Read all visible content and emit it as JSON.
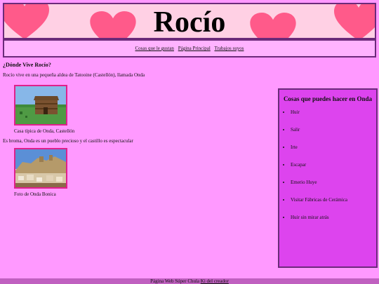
{
  "header": {
    "title": "Rocío",
    "background_color": "#ffd0e4",
    "heart_color": "#ff5a8a"
  },
  "nav": {
    "links": [
      "Cosas que le gustan",
      "Página Principal",
      "Trabajos suyos"
    ]
  },
  "main": {
    "section_title": "¿Dónde Vive Rocío?",
    "intro": "Rocío vive en una pequeña aldea de Tatooine (Castellón), llamada Onda",
    "photo1_caption": "Casa típica de Onda, Castellón",
    "note": "Es broma, Onda es un pueblo precioso y el castillo es espectacular",
    "photo2_caption": "Foto de Onda Bonica"
  },
  "sidebar": {
    "title": "Cosas que puedes hacer en Onda",
    "items": [
      "Huir",
      "Salir",
      "Irte",
      "Escapar",
      "Emerio Huye",
      "Visitar Fábricas de Cerámica",
      "Huir sin mirar atrás"
    ]
  },
  "footer": {
    "text": "Página Web Súper Chula",
    "link": "Ki del creador"
  },
  "colors": {
    "page_bg": "#ff99ff",
    "sidebar_bg": "#dd44ee",
    "footer_bg": "#c060c0",
    "border": "#6b2a7a",
    "photo_border": "#e0208c"
  }
}
